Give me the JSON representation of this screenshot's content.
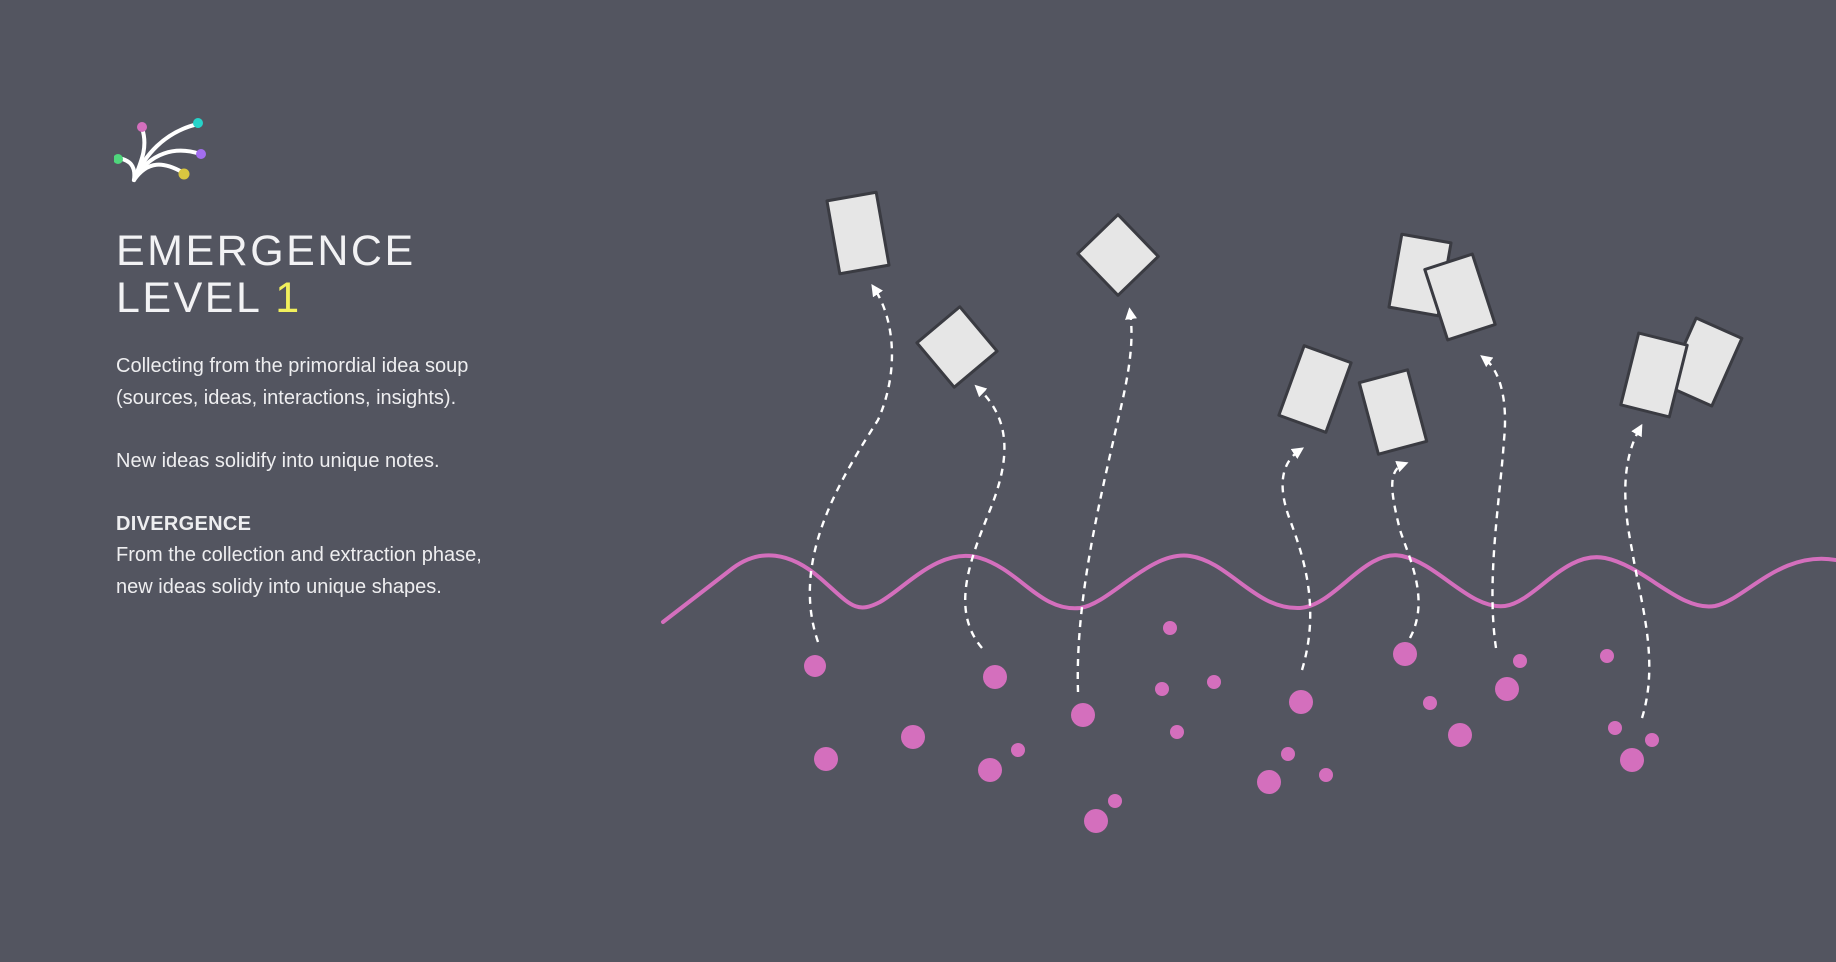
{
  "header": {
    "title_line1": "EMERGENCE",
    "title_line2_word": "LEVEL",
    "title_line2_number": "1"
  },
  "body": {
    "paragraph1": "Collecting from the primordial idea soup (sources, ideas, interactions, insights).",
    "paragraph2": "New ideas solidify into unique notes.",
    "section_heading": "DIVERGENCE",
    "section_text": "From the collection and extraction phase, new ideas solidy into unique shapes."
  },
  "colors": {
    "background": "#535560",
    "wave": "#d46fbd",
    "particle": "#d46fbd",
    "note_fill": "#e6e6e6",
    "note_stroke": "#3a3b42",
    "arrow": "#ffffff",
    "accent": "#f1f05c",
    "logo_dots": [
      "#d46fbd",
      "#26d3c9",
      "#a36ef0",
      "#d9c640",
      "#4fd67c"
    ]
  },
  "icons": {
    "logo": "emergence-burst-icon",
    "note": "note-card-icon",
    "particle": "idea-particle-icon"
  }
}
